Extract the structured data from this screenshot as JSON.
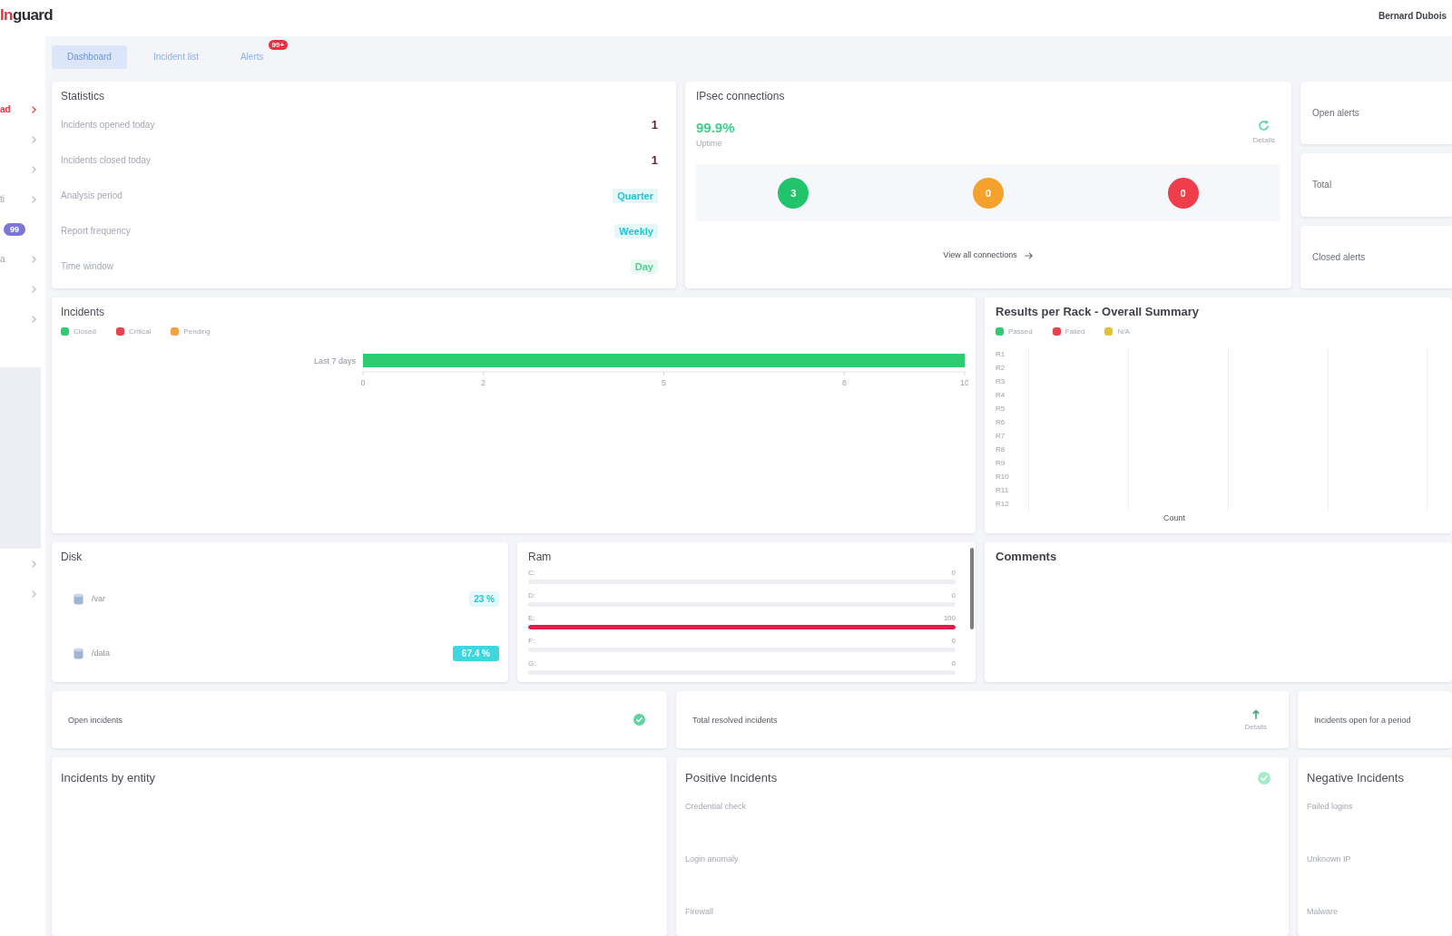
{
  "header": {
    "logo": {
      "accent": "In",
      "name": "guard"
    },
    "user": "Bernard Dubois"
  },
  "sidebar": {
    "groups": [
      {
        "items": [
          {
            "kind": "link",
            "label": "ad",
            "selected": true
          },
          {
            "kind": "link",
            "selected": false
          },
          {
            "kind": "link",
            "selected": false
          },
          {
            "kind": "link",
            "label": "ti",
            "selected": false
          },
          {
            "kind": "badge",
            "label": "99",
            "selected": false
          },
          {
            "kind": "link",
            "label": "a",
            "selected": false
          },
          {
            "kind": "link",
            "selected": false
          },
          {
            "kind": "link",
            "selected": false
          }
        ]
      },
      {
        "items": [
          {
            "kind": "link",
            "selected": false
          },
          {
            "kind": "link",
            "selected": false
          }
        ]
      }
    ]
  },
  "tabs": [
    {
      "label": "Dashboard",
      "selected": true
    },
    {
      "label": "Incident list",
      "selected": false
    },
    {
      "label": "Alerts",
      "selected": false,
      "badge": "99+"
    }
  ],
  "statistics": {
    "title": "Statistics",
    "rows": [
      {
        "kind": "count",
        "label": "Incidents opened today",
        "value": "1"
      },
      {
        "kind": "count",
        "label": "Incidents closed today",
        "value": "1"
      },
      {
        "kind": "tag",
        "label": "Analysis period",
        "value": "Quarter",
        "color": "#1fc6d4"
      },
      {
        "kind": "tag",
        "label": "Report frequency",
        "value": "Weekly",
        "color": "#1fc6d4"
      },
      {
        "kind": "tag",
        "label": "Time window",
        "value": "Day",
        "color": "#4fcf95"
      }
    ]
  },
  "ipsec": {
    "title": "IPsec connections",
    "value": "99.9%",
    "caption": "Uptime",
    "action": "Details",
    "statuses": [
      {
        "count": "3",
        "color": "#22c46b"
      },
      {
        "count": "0",
        "color": "#f5a12e"
      },
      {
        "count": "0",
        "color": "#ee3d4b"
      }
    ],
    "footer": "View all connections"
  },
  "alert_counts": [
    {
      "label": "Open alerts"
    },
    {
      "label": "Total"
    },
    {
      "label": "Closed alerts"
    }
  ],
  "incidents": {
    "title": "Incidents",
    "chart_data": {
      "type": "bar",
      "orientation": "horizontal",
      "stacked": true,
      "categories": [
        "Last 7 days"
      ],
      "series": [
        {
          "name": "Closed",
          "color": "#2ecc71",
          "values": [
            10
          ]
        },
        {
          "name": "Critical",
          "color": "#e8424f",
          "values": [
            0
          ]
        },
        {
          "name": "Pending",
          "color": "#f5a142",
          "values": [
            0
          ]
        }
      ],
      "xlim": [
        0,
        10
      ],
      "xticks": [
        0,
        2,
        5,
        8,
        10
      ],
      "legend": "top"
    }
  },
  "results_per_rack": {
    "title": "Results per Rack - Overall Summary",
    "legend": [
      {
        "label": "Passed",
        "color": "#2ecc71"
      },
      {
        "label": "Failed",
        "color": "#e8424f"
      },
      {
        "label": "N/A",
        "color": "#e3c12c"
      }
    ],
    "rows": [
      "R1",
      "R2",
      "R3",
      "R4",
      "R5",
      "R6",
      "R7",
      "R8",
      "R9",
      "R10",
      "R11",
      "R12"
    ],
    "axis_label": "Count"
  },
  "disk": {
    "title": "Disk",
    "items": [
      {
        "kind": "outline",
        "label": "/var",
        "value": "23 %"
      },
      {
        "kind": "solid",
        "label": "/data",
        "value": "67.4 %"
      }
    ]
  },
  "ram": {
    "title": "Ram",
    "items": [
      {
        "label": "C:",
        "reading": "0",
        "level": 0
      },
      {
        "label": "D:",
        "reading": "0",
        "level": 0
      },
      {
        "label": "E:",
        "reading": "100",
        "level": 1
      },
      {
        "label": "F:",
        "reading": "0",
        "level": 0
      },
      {
        "label": "G:",
        "reading": "0",
        "level": 0
      }
    ]
  },
  "comments": {
    "title": "Comments"
  },
  "counters": [
    {
      "kind": "status",
      "title": "Open incidents"
    },
    {
      "kind": "trend",
      "title": "Total resolved incidents",
      "action": "Details"
    },
    {
      "kind": "plain",
      "title": "Incidents open for a period"
    }
  ],
  "entity": {
    "title": "Incidents by entity"
  },
  "positive": {
    "title": "Positive Incidents",
    "items": [
      "Credential check",
      "Login anomaly",
      "Firewall"
    ]
  },
  "negative": {
    "title": "Negative Incidents",
    "items": [
      "Failed logins",
      "Unknown IP",
      "Malware"
    ]
  }
}
